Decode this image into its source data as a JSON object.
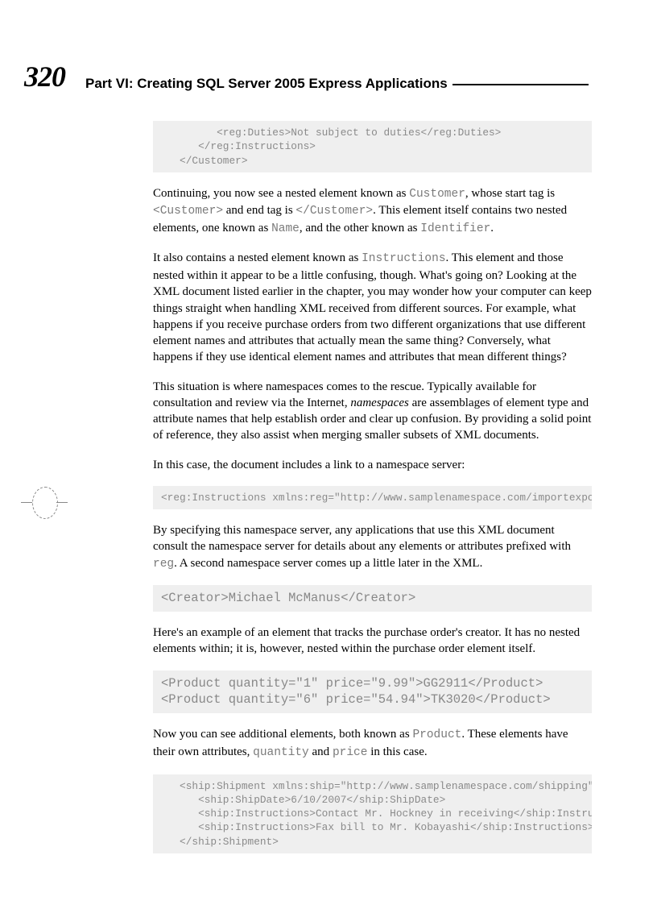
{
  "page_number": "320",
  "header": "Part VI: Creating SQL Server 2005 Express Applications",
  "blocks": {
    "code1": "         <reg:Duties>Not subject to duties</reg:Duties>\n      </reg:Instructions>\n   </Customer>",
    "p1_a": "Continuing, you now see a nested element known as ",
    "p1_c1": "Customer",
    "p1_b": ", whose start tag is ",
    "p1_c2": "<Customer>",
    "p1_c": " and end tag is ",
    "p1_c3": "</Customer>",
    "p1_d": ". This element itself contains two nested elements, one known as ",
    "p1_c4": "Name",
    "p1_e": ", and the other known as ",
    "p1_c5": "Identifier",
    "p1_f": ".",
    "p2_a": "It also contains a nested element known as ",
    "p2_c1": "Instructions",
    "p2_b": ". This element and those nested within it appear to be a little confusing, though. What's going on? Looking at the XML document listed earlier in the chapter, you may wonder how your computer can keep things straight when handling XML received from different sources. For example, what happens if you receive purchase orders from two different organizations that use different element names and attributes that actually mean the same thing? Conversely, what happens if they use identical element names and attributes that mean different things?",
    "p3_a": "This situation is where namespaces comes to the rescue. Typically available for consultation and review via the Internet, ",
    "p3_i": "namespaces",
    "p3_b": " are assemblages of element type and attribute names that help establish order and clear up confusion. By providing a solid point of reference, they also assist when merging smaller subsets of XML documents.",
    "p4": "In this case, the document includes a link to a namespace server:",
    "code2": "<reg:Instructions xmlns:reg=\"http://www.samplenamespace.com/importexport\">",
    "p5_a": "By specifying this namespace server, any applications that use this XML document consult the namespace server for details about any elements or attributes prefixed with ",
    "p5_c1": "reg",
    "p5_b": ". A second namespace server comes up a little later in the XML.",
    "code3": "<Creator>Michael McManus</Creator>",
    "p6": "Here's an example of an element that tracks the purchase order's creator. It has no nested elements within; it is, however, nested within the purchase order element itself.",
    "code4": "<Product quantity=\"1\" price=\"9.99\">GG2911</Product>\n<Product quantity=\"6\" price=\"54.94\">TK3020</Product>",
    "p7_a": "Now you can see additional elements, both known as ",
    "p7_c1": "Product",
    "p7_b": ". These elements have their own attributes, ",
    "p7_c2": "quantity",
    "p7_c": " and ",
    "p7_c3": "price",
    "p7_d": " in this case.",
    "code5": "   <ship:Shipment xmlns:ship=\"http://www.samplenamespace.com/shipping\">\n      <ship:ShipDate>6/10/2007</ship:ShipDate>\n      <ship:Instructions>Contact Mr. Hockney in receiving</ship:Instructions>\n      <ship:Instructions>Fax bill to Mr. Kobayashi</ship:Instructions>\n   </ship:Shipment>"
  }
}
